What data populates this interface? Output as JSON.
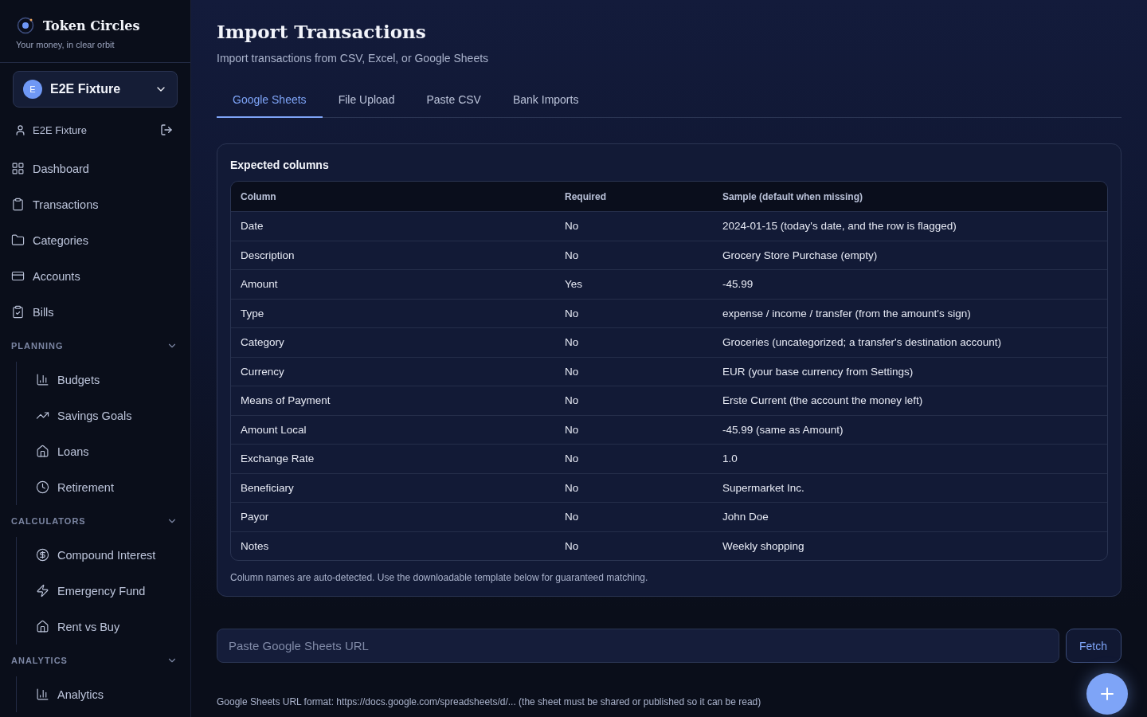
{
  "brand": {
    "name": "Token Circles",
    "tagline": "Your money, in clear orbit"
  },
  "workspace": {
    "initial": "E",
    "name": "E2E Fixture"
  },
  "user": {
    "name": "E2E Fixture"
  },
  "nav": [
    {
      "label": "Dashboard",
      "selected": false
    },
    {
      "label": "Transactions",
      "selected": false
    },
    {
      "label": "Categories",
      "selected": false
    },
    {
      "label": "Accounts",
      "selected": false
    },
    {
      "label": "Bills",
      "selected": false
    }
  ],
  "sections": [
    {
      "title": "PLANNING",
      "expanded": true,
      "items": [
        {
          "label": "Budgets",
          "selected": false
        },
        {
          "label": "Savings Goals",
          "selected": false
        },
        {
          "label": "Loans",
          "selected": false
        },
        {
          "label": "Retirement",
          "selected": false
        }
      ]
    },
    {
      "title": "CALCULATORS",
      "expanded": true,
      "items": [
        {
          "label": "Compound Interest",
          "selected": false
        },
        {
          "label": "Emergency Fund",
          "selected": false
        },
        {
          "label": "Rent vs Buy",
          "selected": false
        }
      ]
    },
    {
      "title": "ANALYTICS",
      "expanded": true,
      "items": [
        {
          "label": "Analytics",
          "selected": false
        }
      ]
    }
  ],
  "page": {
    "title": "Import Transactions",
    "subtitle": "Import transactions from CSV, Excel, or Google Sheets"
  },
  "tabs": [
    {
      "label": "Google Sheets",
      "selected": true
    },
    {
      "label": "File Upload",
      "selected": false
    },
    {
      "label": "Paste CSV",
      "selected": false
    },
    {
      "label": "Bank Imports",
      "selected": false
    }
  ],
  "card": {
    "title": "Expected columns",
    "note": "Column names are auto-detected. Use the downloadable template below for guaranteed matching."
  },
  "table": {
    "columns": [
      "Column",
      "Required",
      "Sample (default when missing)"
    ],
    "rows": [
      [
        "Date",
        "No",
        "2024-01-15 (today's date, and the row is flagged)"
      ],
      [
        "Description",
        "No",
        "Grocery Store Purchase (empty)"
      ],
      [
        "Amount",
        "Yes",
        "-45.99"
      ],
      [
        "Type",
        "No",
        "expense / income / transfer (from the amount's sign)"
      ],
      [
        "Category",
        "No",
        "Groceries (uncategorized; a transfer's destination account)"
      ],
      [
        "Currency",
        "No",
        "EUR (your base currency from Settings)"
      ],
      [
        "Means of Payment",
        "No",
        "Erste Current (the account the money left)"
      ],
      [
        "Amount Local",
        "No",
        "-45.99 (same as Amount)"
      ],
      [
        "Exchange Rate",
        "No",
        "1.0"
      ],
      [
        "Beneficiary",
        "No",
        "Supermarket Inc."
      ],
      [
        "Payor",
        "No",
        "John Doe"
      ],
      [
        "Notes",
        "No",
        "Weekly shopping"
      ]
    ]
  },
  "url_field": {
    "placeholder": "Paste Google Sheets URL"
  },
  "fetch_button": "Fetch",
  "hint": "Google Sheets URL format: https://docs.google.com/spreadsheets/d/... (the sheet must be shared or published so it can be read)"
}
